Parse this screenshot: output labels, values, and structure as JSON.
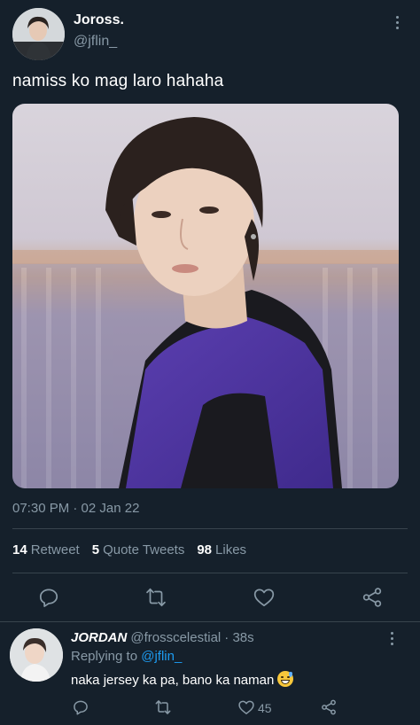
{
  "tweet": {
    "author_name": "Joross.",
    "author_handle": "@jflin_",
    "text": "namiss ko mag laro hahaha",
    "timestamp": "07:30 PM · 02 Jan 22",
    "stats": {
      "retweets_count": "14",
      "retweets_label": "Retweet",
      "quotes_count": "5",
      "quotes_label": "Quote Tweets",
      "likes_count": "98",
      "likes_label": "Likes"
    }
  },
  "reply": {
    "author_name": "JORDAN",
    "author_handle": "@frosscelestial",
    "time": "· 38s",
    "replying_prefix": "Replying to",
    "replying_to": "@jflin_",
    "text": "naka jersey ka pa, bano ka naman",
    "likes": "45"
  },
  "icons": [
    "more-vertical-icon",
    "reply-icon",
    "retweet-icon",
    "like-icon",
    "share-icon",
    "grinning-sweat-emoji"
  ],
  "colors": {
    "background": "#15202b",
    "secondary_text": "#8899a6",
    "link": "#1d9bf0",
    "divider": "#38444d"
  }
}
